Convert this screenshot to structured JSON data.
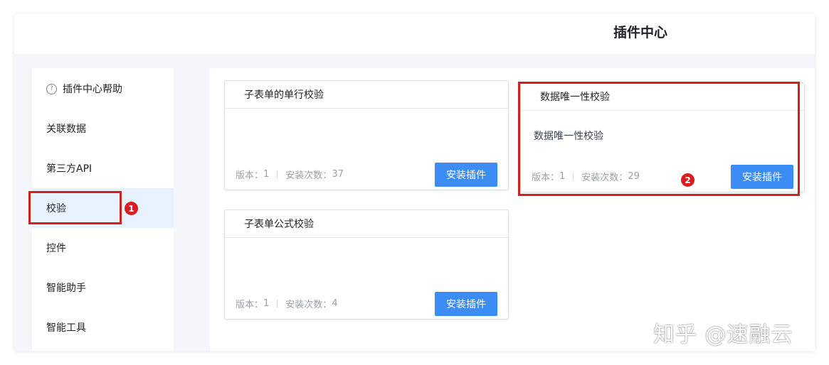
{
  "header": {
    "title": "插件中心"
  },
  "sidebar": {
    "help_label": "插件中心帮助",
    "help_icon": "question-circle-icon",
    "items": [
      {
        "label": "关联数据"
      },
      {
        "label": "第三方API"
      },
      {
        "label": "校验",
        "active": true
      },
      {
        "label": "控件"
      },
      {
        "label": "智能助手"
      },
      {
        "label": "智能工具"
      }
    ]
  },
  "plugins": [
    {
      "name": "子表单的单行校验",
      "description": "",
      "version_label": "版本：",
      "version": "1",
      "installs_label": "安装次数：",
      "installs": "37",
      "install_button": "安装插件"
    },
    {
      "name": "数据唯一性校验",
      "description": "数据唯一性校验",
      "version_label": "版本：",
      "version": "1",
      "installs_label": "安装次数：",
      "installs": "29",
      "install_button": "安装插件"
    },
    {
      "name": "子表单公式校验",
      "description": "",
      "version_label": "版本：",
      "version": "1",
      "installs_label": "安装次数：",
      "installs": "4",
      "install_button": "安装插件"
    }
  ],
  "annotations": {
    "badge1": "1",
    "badge2": "2"
  },
  "watermark": "知乎 @速融云",
  "colors": {
    "accent": "#3b8cf5",
    "annotation_red": "#d21f1f",
    "active_bg": "#e8f2ff"
  }
}
